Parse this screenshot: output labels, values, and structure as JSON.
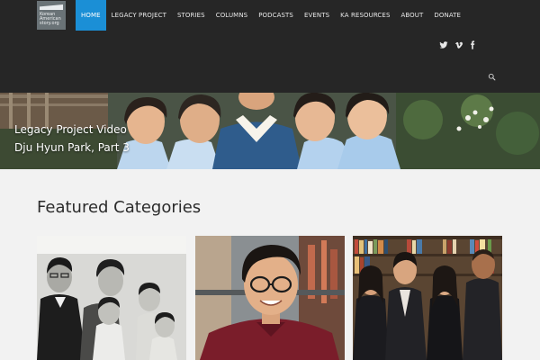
{
  "logo": {
    "lines": [
      "Korean",
      "American",
      "story.org"
    ]
  },
  "nav": {
    "items": [
      {
        "label": "HOME",
        "active": true
      },
      {
        "label": "LEGACY PROJECT",
        "active": false
      },
      {
        "label": "STORIES",
        "active": false
      },
      {
        "label": "COLUMNS",
        "active": false
      },
      {
        "label": "PODCASTS",
        "active": false
      },
      {
        "label": "EVENTS",
        "active": false
      },
      {
        "label": "KA RESOURCES",
        "active": false
      },
      {
        "label": "ABOUT",
        "active": false
      },
      {
        "label": "DONATE",
        "active": false
      }
    ]
  },
  "social": {
    "icons": [
      "twitter-icon",
      "vimeo-icon",
      "facebook-icon"
    ]
  },
  "search": {
    "icon": "search-icon"
  },
  "hero": {
    "title": "Legacy Project Video",
    "subtitle": "Dju Hyun Park, Part 3"
  },
  "featured": {
    "heading": "Featured Categories",
    "cards": [
      {
        "image": "vintage-family-photo"
      },
      {
        "image": "portrait-man-glasses"
      },
      {
        "image": "group-photo-bookshelf"
      }
    ]
  },
  "colors": {
    "header_bg": "#262626",
    "accent": "#1b8fd6",
    "page_bg": "#f2f2f2"
  }
}
